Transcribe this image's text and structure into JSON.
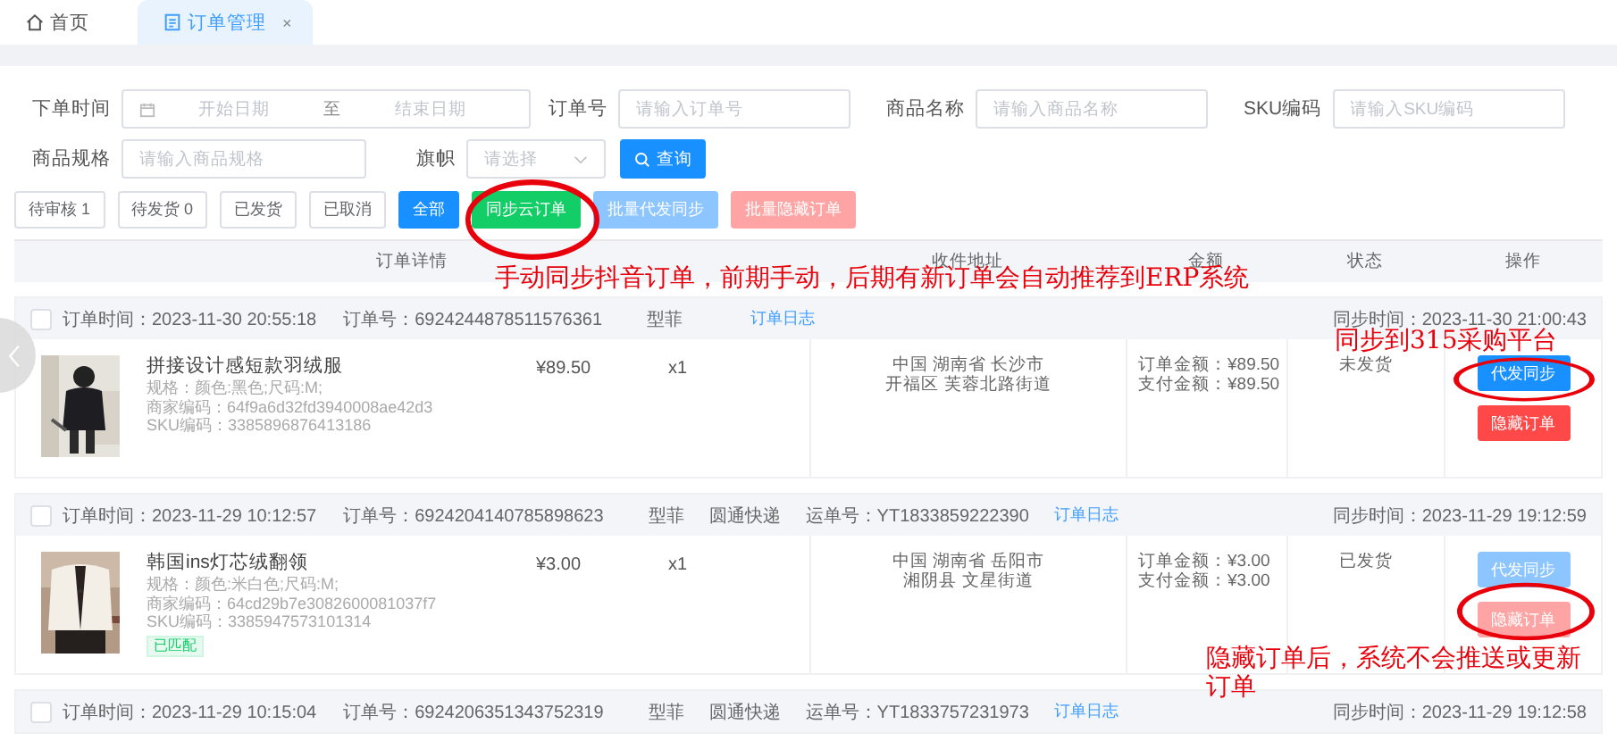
{
  "tabs": [
    {
      "label": "首页",
      "selected": false
    },
    {
      "label": "订单管理",
      "close": "×",
      "selected": true
    }
  ],
  "filters": {
    "row1": [
      {
        "label": "下单时间",
        "kind": "daterange",
        "start": "开始日期",
        "separator": "至",
        "end": "结束日期"
      },
      {
        "label": "订单号",
        "kind": "text",
        "placeholder": "请输入订单号"
      },
      {
        "label": "商品名称",
        "kind": "text",
        "placeholder": "请输入商品名称"
      },
      {
        "label": "SKU编码",
        "kind": "text",
        "placeholder": "请输入SKU编码"
      }
    ],
    "row2": [
      {
        "label": "商品规格",
        "kind": "text",
        "placeholder": "请输入商品规格"
      },
      {
        "label": "旗帜",
        "kind": "select",
        "placeholder": "请选择"
      }
    ],
    "search_button": "查询"
  },
  "status_filters": [
    {
      "label": "待审核 1",
      "selected": false
    },
    {
      "label": "待发货 0",
      "selected": false
    },
    {
      "label": "已发货",
      "selected": false
    },
    {
      "label": "已取消",
      "selected": false
    },
    {
      "label": "全部",
      "selected": true
    }
  ],
  "actions": [
    {
      "label": "同步云订单",
      "kind": "success",
      "disabled": false
    },
    {
      "label": "批量代发同步",
      "kind": "primary",
      "disabled": true
    },
    {
      "label": "批量隐藏订单",
      "kind": "danger",
      "disabled": true
    }
  ],
  "table": {
    "columns": [
      "订单详情",
      "收件地址",
      "金额",
      "状态",
      "操作"
    ],
    "orders": [
      {
        "checked": false,
        "time": "订单时间：2023-11-30 20:55:18",
        "number": "订单号：6924244878511576361",
        "shop": "型菲",
        "log": "订单日志",
        "sync": "同步时间：2023-11-30 21:00:43",
        "product": {
          "name": "拼接设计感短款羽绒服",
          "spec": "规格：颜色:黑色;尺码:M;",
          "merchant_code": "商家编码：64f9a6d32fd3940008ae42d3",
          "sku": "SKU编码：3385896876413186"
        },
        "price": "¥89.50",
        "qty": "x1",
        "address": [
          "中国 湖南省 长沙市",
          "开福区 芙蓉北路街道"
        ],
        "amounts": [
          "订单金额：¥89.50",
          "支付金额：¥89.50"
        ],
        "status": "未发货",
        "buttons": [
          {
            "label": "代发同步",
            "kind": "primary",
            "disabled": false
          },
          {
            "label": "隐藏订单",
            "kind": "danger",
            "disabled": false
          }
        ]
      },
      {
        "checked": false,
        "time": "订单时间：2023-11-29 10:12:57",
        "number": "订单号：6924204140785898623",
        "shop": "型菲",
        "carrier": "圆通快递",
        "waybill": "运单号：YT1833859222390",
        "log": "订单日志",
        "sync": "同步时间：2023-11-29 19:12:59",
        "product": {
          "name": "韩国ins灯芯绒翻领",
          "spec": "规格：颜色:米白色;尺码:M;",
          "merchant_code": "商家编码：64cd29b7e3082600081037f7",
          "sku": "SKU编码：3385947573101314",
          "tag": "已匹配"
        },
        "price": "¥3.00",
        "qty": "x1",
        "address": [
          "中国 湖南省 岳阳市",
          "湘阴县 文星街道"
        ],
        "amounts": [
          "订单金额：¥3.00",
          "支付金额：¥3.00"
        ],
        "status": "已发货",
        "buttons": [
          {
            "label": "代发同步",
            "kind": "primary",
            "disabled": true
          },
          {
            "label": "隐藏订单",
            "kind": "danger",
            "disabled": true
          }
        ]
      },
      {
        "checked": false,
        "time": "订单时间：2023-11-29 10:15:04",
        "number": "订单号：6924206351343752319",
        "shop": "型菲",
        "carrier": "圆通快递",
        "waybill": "运单号：YT1833757231973",
        "log": "订单日志",
        "sync": "同步时间：2023-11-29 19:12:58"
      }
    ]
  },
  "annotations": [
    "手动同步抖音订单，前期手动，后期有新订单会自动推荐到ERP系统",
    "同步到315采购平台",
    "隐藏订单后，系统不会推送或更新订单"
  ]
}
